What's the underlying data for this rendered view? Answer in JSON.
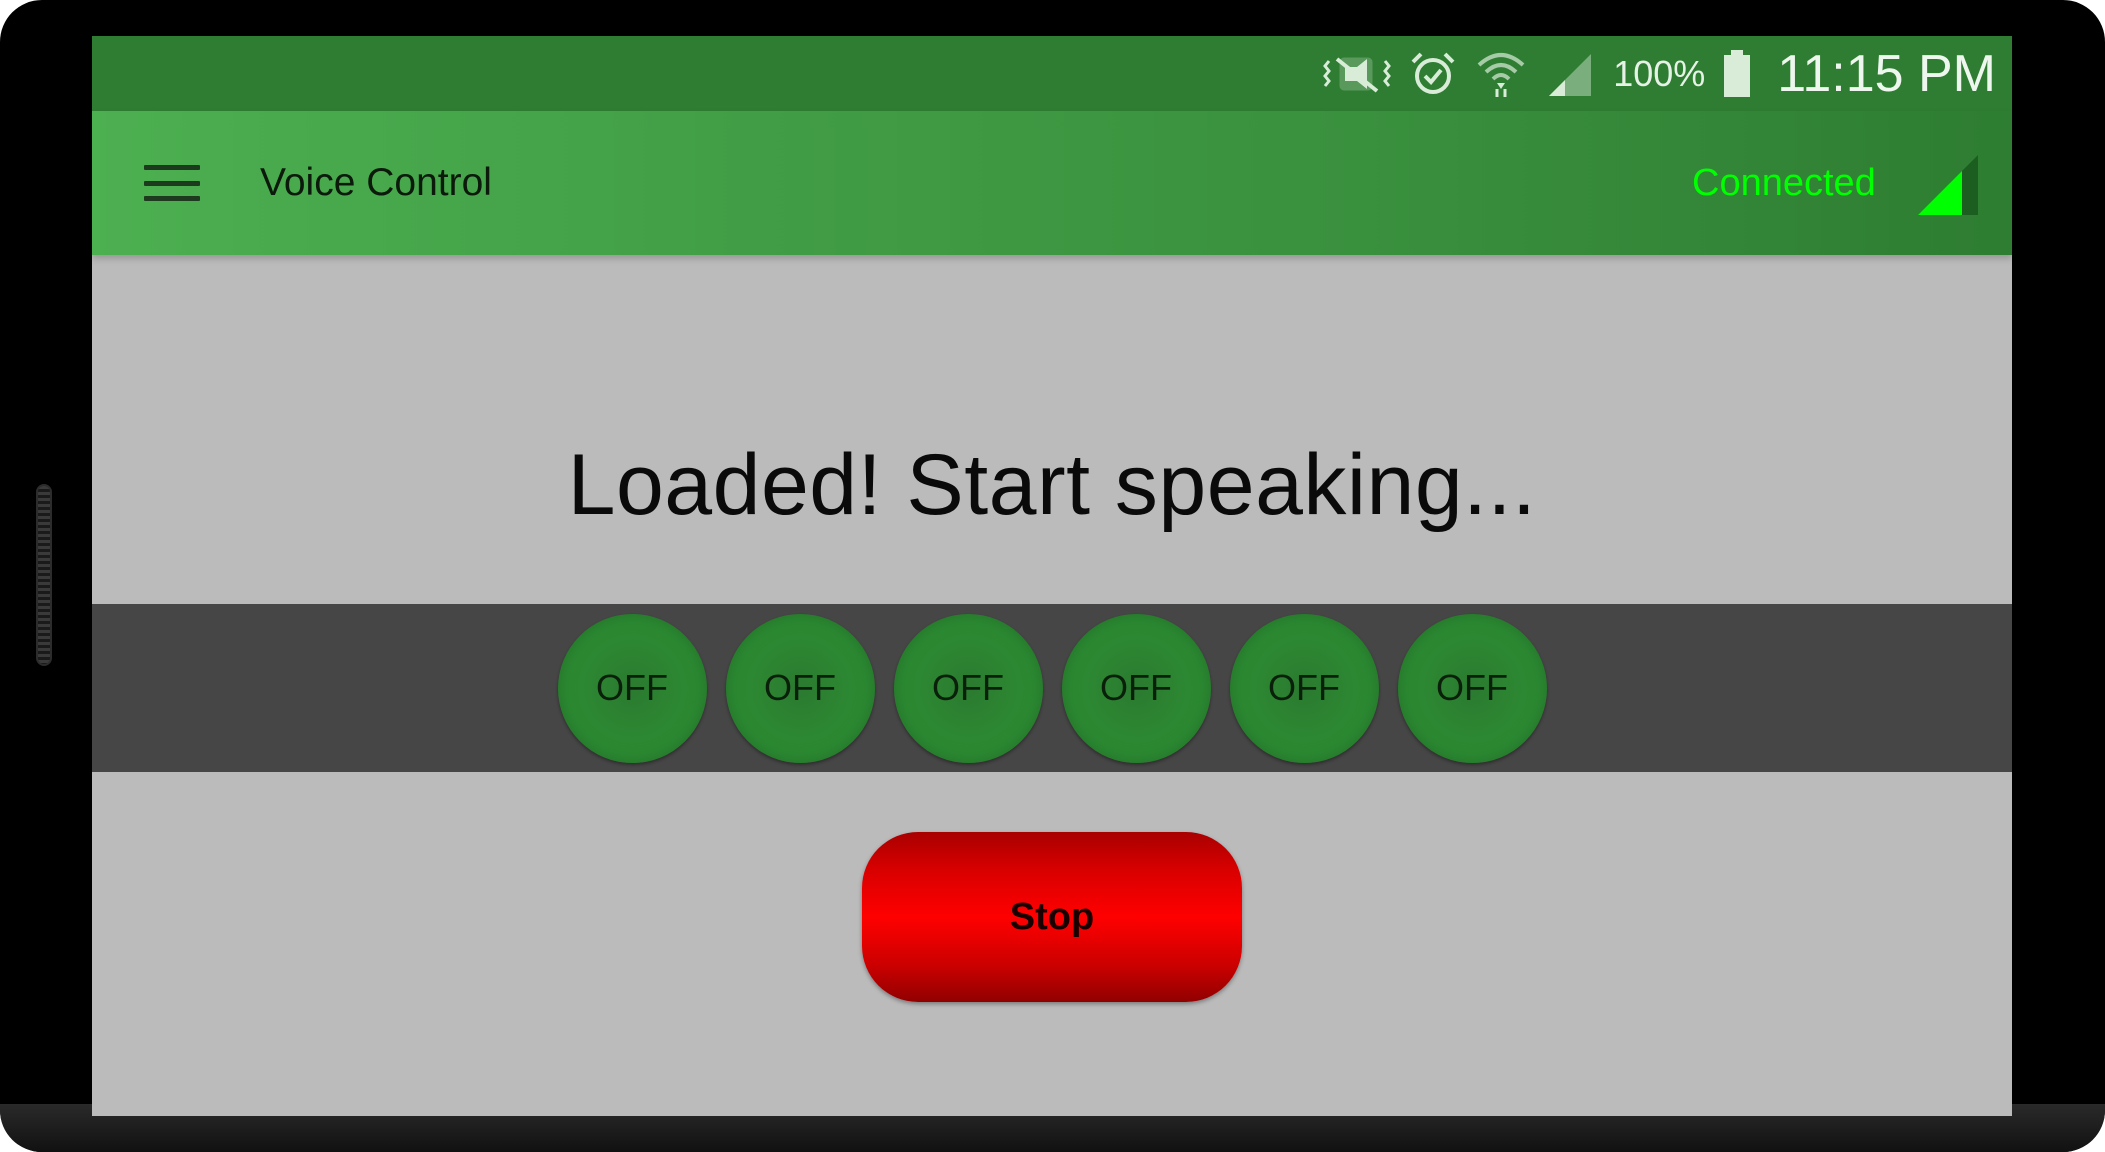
{
  "status_bar": {
    "icons": [
      "mute-vibrate-icon",
      "alarm-icon",
      "wifi-icon",
      "cell-signal-icon",
      "battery-icon"
    ],
    "battery_percent": "100%",
    "time": "11:15 PM",
    "color": "#2e7d32"
  },
  "app_bar": {
    "menu_icon": "hamburger-menu-icon",
    "title": "Voice Control",
    "connection_status": "Connected",
    "connection_icon": "signal-triangle-icon",
    "connection_color": "#00ff00",
    "gradient_start": "#4caf50",
    "gradient_end": "#2e7d32"
  },
  "main": {
    "message": "Loaded! Start speaking...",
    "background": "#bbbbbb"
  },
  "toggles": [
    {
      "label": "OFF"
    },
    {
      "label": "OFF"
    },
    {
      "label": "OFF"
    },
    {
      "label": "OFF"
    },
    {
      "label": "OFF"
    },
    {
      "label": "OFF"
    }
  ],
  "stop_button": {
    "label": "Stop",
    "color": "#ff0000"
  }
}
